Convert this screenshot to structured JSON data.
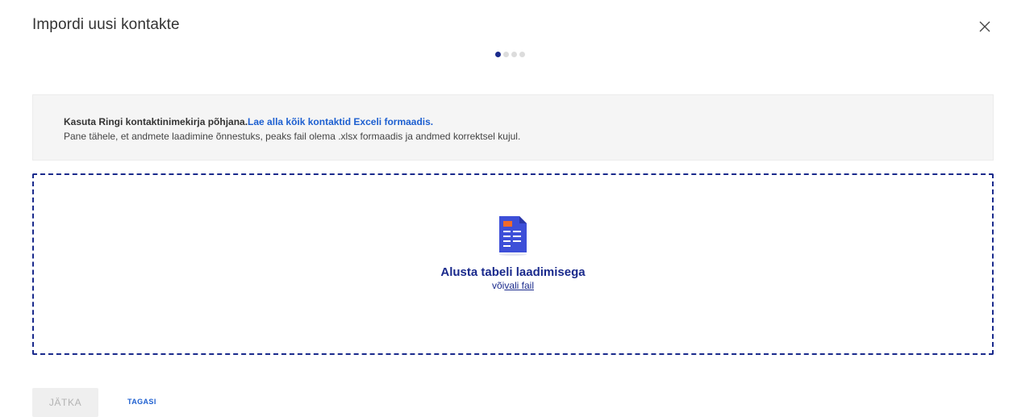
{
  "dialog": {
    "title": "Impordi uusi kontakte",
    "close_icon": "close-icon"
  },
  "stepper": {
    "total_steps": 4,
    "current_step": 1
  },
  "info": {
    "line1_bold": "Kasuta Ringi kontaktinimekirja põhjana.",
    "line1_link": "Lae alla kõik kontaktid Exceli formaadis.",
    "line2": "Pane tähele, et andmete laadimine õnnestuks, peaks fail olema .xlsx formaadis ja andmed korrektsel kujul."
  },
  "dropzone": {
    "icon": "document-icon",
    "title": "Alusta tabeli laadimisega",
    "or_text": "või",
    "choose_file_link": "vali fail"
  },
  "footer": {
    "continue_label": "JÄTKA",
    "continue_disabled": true,
    "back_label": "TAGASI"
  },
  "colors": {
    "accent_dark": "#1a2a8c",
    "link_blue": "#1d5fd0",
    "doc_icon_blue": "#3d4fd8",
    "doc_icon_orange": "#f06a2a"
  }
}
